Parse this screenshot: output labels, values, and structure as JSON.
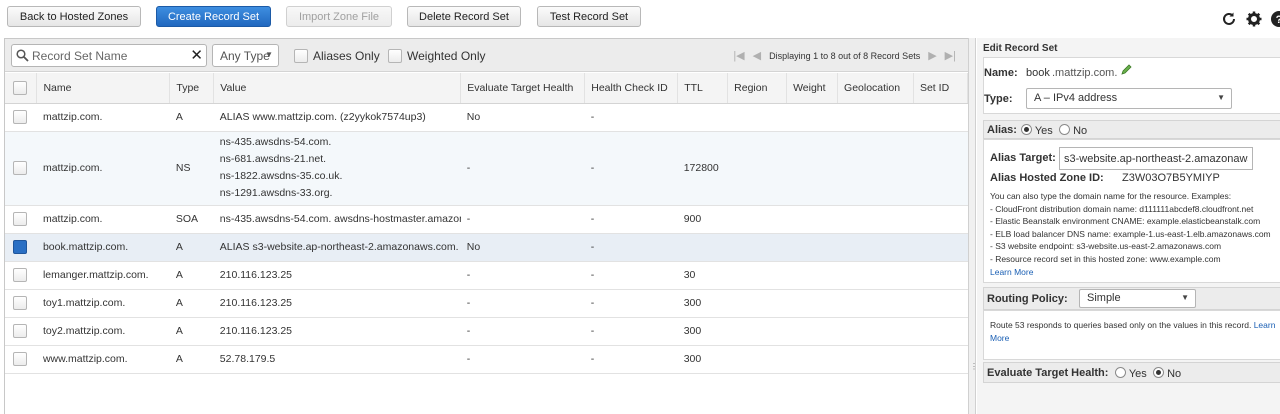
{
  "toolbar": {
    "back_label": "Back to Hosted Zones",
    "create_label": "Create Record Set",
    "import_label": "Import Zone File",
    "delete_label": "Delete Record Set",
    "test_label": "Test Record Set"
  },
  "filters": {
    "search_placeholder": "Record Set Name",
    "type_value": "Any Type",
    "aliases_only": "Aliases Only",
    "weighted_only": "Weighted Only",
    "pagination": "Displaying 1 to 8 out of 8 Record Sets"
  },
  "table": {
    "headers": [
      "Name",
      "Type",
      "Value",
      "Evaluate Target Health",
      "Health Check ID",
      "TTL",
      "Region",
      "Weight",
      "Geolocation",
      "Set ID"
    ],
    "rows": [
      {
        "name": "mattzip.com.",
        "type": "A",
        "value": "ALIAS www.mattzip.com. (z2yykok7574up3)",
        "eth": "No",
        "hc": "-",
        "ttl": ""
      },
      {
        "name": "mattzip.com.",
        "type": "NS",
        "values": [
          "ns-435.awsdns-54.com.",
          "ns-681.awsdns-21.net.",
          "ns-1822.awsdns-35.co.uk.",
          "ns-1291.awsdns-33.org."
        ],
        "eth": "-",
        "hc": "-",
        "ttl": "172800"
      },
      {
        "name": "mattzip.com.",
        "type": "SOA",
        "value": "ns-435.awsdns-54.com. awsdns-hostmaster.amazon",
        "eth": "-",
        "hc": "-",
        "ttl": "900"
      },
      {
        "name": "book.mattzip.com.",
        "type": "A",
        "value": "ALIAS s3-website.ap-northeast-2.amazonaws.com.",
        "eth": "No",
        "hc": "-",
        "ttl": ""
      },
      {
        "name": "lemanger.mattzip.com.",
        "type": "A",
        "value": "210.116.123.25",
        "eth": "-",
        "hc": "-",
        "ttl": "30"
      },
      {
        "name": "toy1.mattzip.com.",
        "type": "A",
        "value": "210.116.123.25",
        "eth": "-",
        "hc": "-",
        "ttl": "300"
      },
      {
        "name": "toy2.mattzip.com.",
        "type": "A",
        "value": "210.116.123.25",
        "eth": "-",
        "hc": "-",
        "ttl": "300"
      },
      {
        "name": "www.mattzip.com.",
        "type": "A",
        "value": "52.78.179.5",
        "eth": "-",
        "hc": "-",
        "ttl": "300"
      }
    ]
  },
  "edit": {
    "title": "Edit Record Set",
    "name_label": "Name:",
    "name_prefix": "book",
    "name_domain": ".mattzip.com.",
    "type_label": "Type:",
    "type_value": "A – IPv4 address",
    "alias_label": "Alias:",
    "yes": "Yes",
    "no": "No",
    "alias_target_label": "Alias Target:",
    "alias_target_value": "s3-website.ap-northeast-2.amazonaws",
    "hosted_zone_label": "Alias Hosted Zone ID:",
    "hosted_zone_value": "Z3W03O7B5YMIYP",
    "help_intro": "You can also type the domain name for the resource. Examples:",
    "help_items": [
      "- CloudFront distribution domain name: d111111abcdef8.cloudfront.net",
      "- Elastic Beanstalk environment CNAME: example.elasticbeanstalk.com",
      "- ELB load balancer DNS name: example-1.us-east-1.elb.amazonaws.com",
      "- S3 website endpoint: s3-website.us-east-2.amazonaws.com",
      "- Resource record set in this hosted zone: www.example.com"
    ],
    "learn_more": "Learn More",
    "routing_label": "Routing Policy:",
    "routing_value": "Simple",
    "routing_help": "Route 53 responds to queries based only on the values in this record.",
    "routing_learn": "Learn",
    "routing_more": "More",
    "eth_label": "Evaluate Target Health:"
  }
}
